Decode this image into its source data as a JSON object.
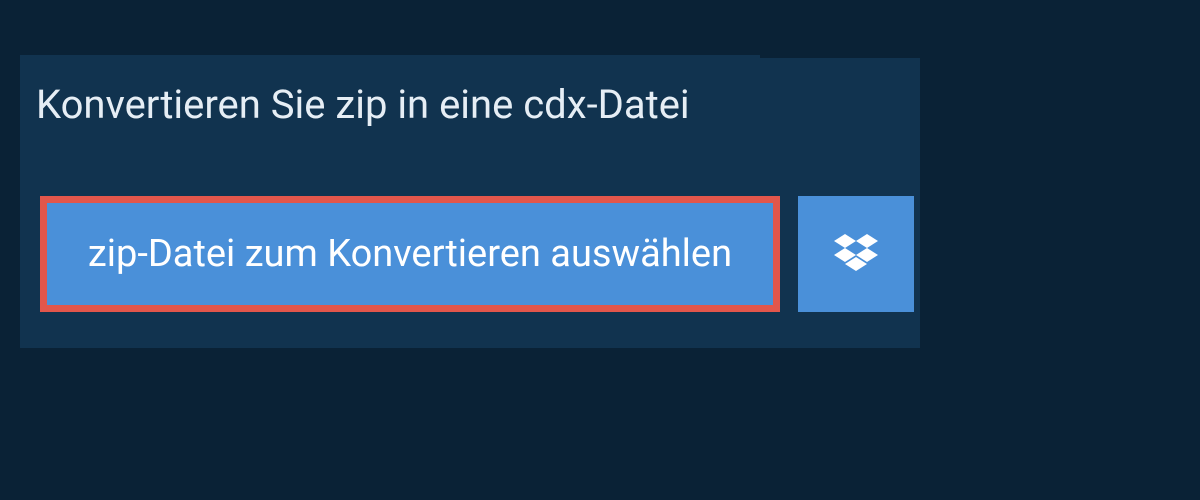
{
  "title": "Konvertieren Sie zip in eine cdx-Datei",
  "file_select_label": "zip-Datei zum Konvertieren auswählen",
  "colors": {
    "page_bg": "#0a2236",
    "panel_bg": "#11334f",
    "button_bg": "#4a90d9",
    "highlight_border": "#e2564b",
    "text_light": "#e6eef5",
    "text_white": "#ffffff"
  }
}
